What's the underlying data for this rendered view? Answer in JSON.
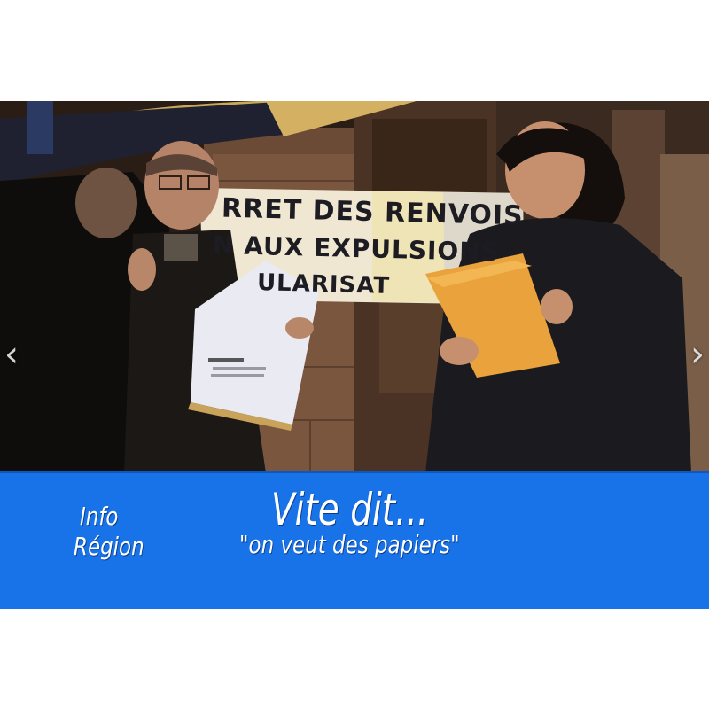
{
  "banner": {
    "line1": "RRET DES RENVOIS",
    "line2": "N AUX EXPULSIONS",
    "line3": "ULARISAT"
  },
  "lower_third": {
    "program_line1": "Info",
    "program_line2": "Région",
    "title": "Vite dit...",
    "subtitle": "\"on veut des papiers\""
  },
  "navigation": {
    "prev_icon": "chevron-left-icon",
    "next_icon": "chevron-right-icon",
    "prev_glyph": "‹",
    "next_glyph": "›"
  },
  "colors": {
    "lower_third_bg": "#1873e8",
    "page_bg": "#ffffff"
  }
}
